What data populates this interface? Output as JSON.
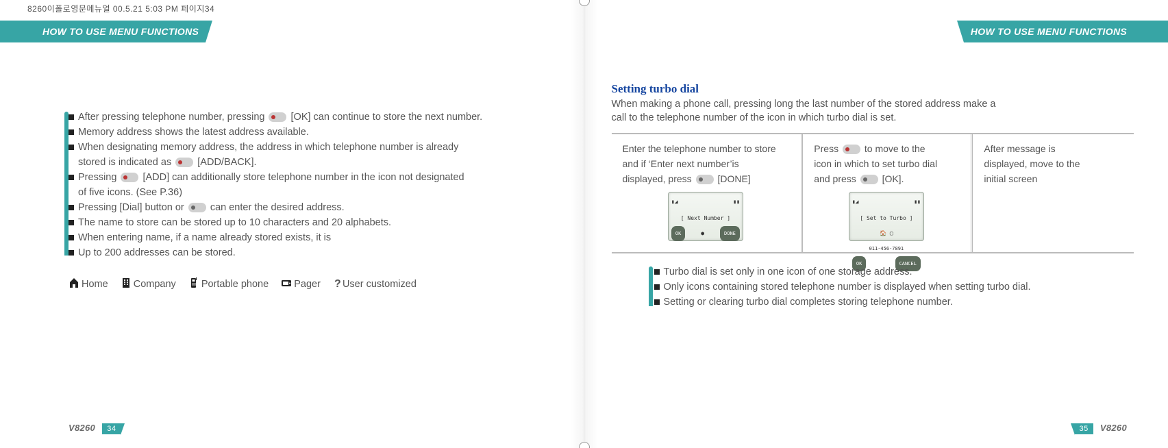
{
  "header_filename": "8260이폴로영문메뉴얼   00.5.21 5:03 PM  페이지34",
  "left": {
    "tab": "HOW TO USE MENU FUNCTIONS",
    "bullets": [
      {
        "pre": "After pressing telephone  number, pressing ",
        "icon": "red",
        "post": "[OK] can  continue to store  the next number."
      },
      {
        "pre": "Memory address shows the latest address available.",
        "icon": null,
        "post": ""
      },
      {
        "pre": "When designating memory address, the address in which  telephone number is already",
        "icon": null,
        "post": "",
        "cont": {
          "pre": "stored is indicated as ",
          "icon": "red",
          "post": "[ADD/BACK]."
        }
      },
      {
        "pre": "Pressing ",
        "icon": "red",
        "post": " [ADD] can additionally store telephone  number in the icon not designated",
        "cont": {
          "pre": "of five icons. (See P.36)",
          "icon": null,
          "post": ""
        }
      },
      {
        "pre": "Pressing [Dial] button or ",
        "icon": "grey",
        "post": " can enter the desired address."
      },
      {
        "pre": "The name to store can be stored up to 10 characters and 20 alphabets.",
        "icon": null,
        "post": ""
      },
      {
        "pre": "When entering name, if a name already stored exists, it is",
        "icon": null,
        "post": ""
      },
      {
        "pre": "Up to 200 addresses can be stored.",
        "icon": null,
        "post": ""
      }
    ],
    "legend": {
      "home": "Home",
      "company": "Company",
      "portable": "Portable phone",
      "pager": "Pager",
      "user": "User customized"
    },
    "footer_model": "V8260",
    "footer_page": "34"
  },
  "right": {
    "tab": "HOW TO USE MENU FUNCTIONS",
    "section_title": "Setting turbo dial",
    "section_intro_a": "When making a phone call, pressing long the last number of the stored address make a",
    "section_intro_b": "call to the telephone number of the icon in which turbo dial is set.",
    "steps": [
      {
        "text_a": "Enter the telephone number to store",
        "text_b": "and if ‘Enter next number’is",
        "text_c_pre": "displayed, press ",
        "text_c_post": "[DONE]",
        "screen": {
          "title": "[ Next Number ]",
          "mid": "",
          "bl": "OK",
          "br": "DONE"
        }
      },
      {
        "text_a_pre": "Press ",
        "text_a_post": " to move to the",
        "text_b": "icon in which to set turbo dial",
        "text_c_pre": "and press ",
        "text_c_post": "[OK].",
        "screen": {
          "title": "[ Set to Turbo ]",
          "mid": "011-456-7891",
          "bl": "OK",
          "br": "CANCEL"
        }
      },
      {
        "text_a": "After message is",
        "text_b": "displayed, move to the",
        "text_c": "initial screen"
      }
    ],
    "notes": [
      "Turbo dial is set only in one icon of one storage address.",
      "Only icons containing stored telephone number is displayed when setting turbo dial.",
      "Setting or clearing turbo dial completes storing telephone number."
    ],
    "footer_model": "V8260",
    "footer_page": "35"
  }
}
